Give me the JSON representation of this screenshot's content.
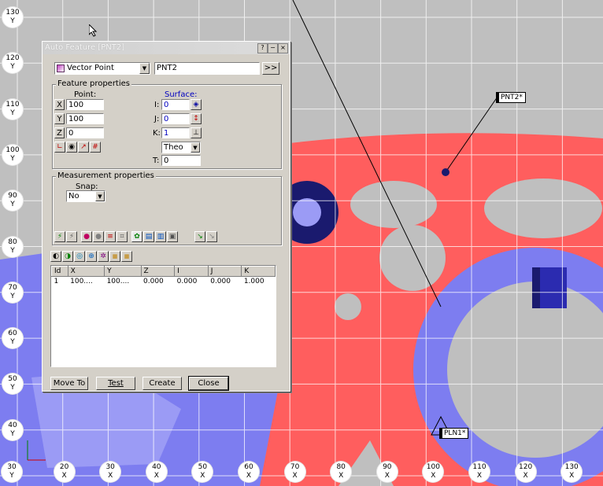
{
  "viewport": {
    "grid_rows": [
      {
        "n": "130",
        "a": "Y"
      },
      {
        "n": "120",
        "a": "Y"
      },
      {
        "n": "110",
        "a": "Y"
      },
      {
        "n": "100",
        "a": "Y"
      },
      {
        "n": "90",
        "a": "Y"
      },
      {
        "n": "80",
        "a": "Y"
      },
      {
        "n": "70",
        "a": "Y"
      },
      {
        "n": "60",
        "a": "Y"
      },
      {
        "n": "50",
        "a": "Y"
      },
      {
        "n": "40",
        "a": "Y"
      }
    ],
    "grid_cols": [
      {
        "n": "30",
        "a": "Y"
      },
      {
        "n": "20",
        "a": "X"
      },
      {
        "n": "30",
        "a": "X"
      },
      {
        "n": "40",
        "a": "X"
      },
      {
        "n": "50",
        "a": "X"
      },
      {
        "n": "60",
        "a": "X"
      },
      {
        "n": "70",
        "a": "X"
      },
      {
        "n": "80",
        "a": "X"
      },
      {
        "n": "90",
        "a": "X"
      },
      {
        "n": "100",
        "a": "X"
      },
      {
        "n": "110",
        "a": "X"
      },
      {
        "n": "120",
        "a": "X"
      },
      {
        "n": "130",
        "a": "X"
      }
    ],
    "pnt2_label": "PNT2*",
    "pln1_label": "PLN1*",
    "colors": {
      "part": "#ff5e5e",
      "blue": "#7d7df0",
      "dark_blue": "#1a1a6e",
      "background": "#bfbfbf"
    }
  },
  "dialog": {
    "title": "Auto Feature [PNT2]",
    "feature_type": "Vector Point",
    "feature_name": "PNT2",
    "expand_label": ">>",
    "feature_properties_label": "Feature properties",
    "point_label": "Point:",
    "surface_label": "Surface:",
    "x_axis": "X",
    "y_axis": "Y",
    "z_axis": "Z",
    "x_value": "100",
    "y_value": "100",
    "z_value": "0",
    "i_label": "I:",
    "j_label": "J:",
    "k_label": "K:",
    "t_label": "T:",
    "i_value": "0",
    "j_value": "0",
    "k_value": "1",
    "t_value": "0",
    "theo_value": "Theo",
    "measurement_properties_label": "Measurement properties",
    "snap_label": "Snap:",
    "snap_value": "No",
    "columns": [
      "Id",
      "X",
      "Y",
      "Z",
      "I",
      "J",
      "K"
    ],
    "rows": [
      [
        "1",
        "100....",
        "100....",
        "0.000",
        "0.000",
        "0.000",
        "1.000"
      ]
    ],
    "buttons": {
      "move_to": "Move To",
      "test": "Test",
      "create": "Create",
      "close": "Close"
    }
  }
}
